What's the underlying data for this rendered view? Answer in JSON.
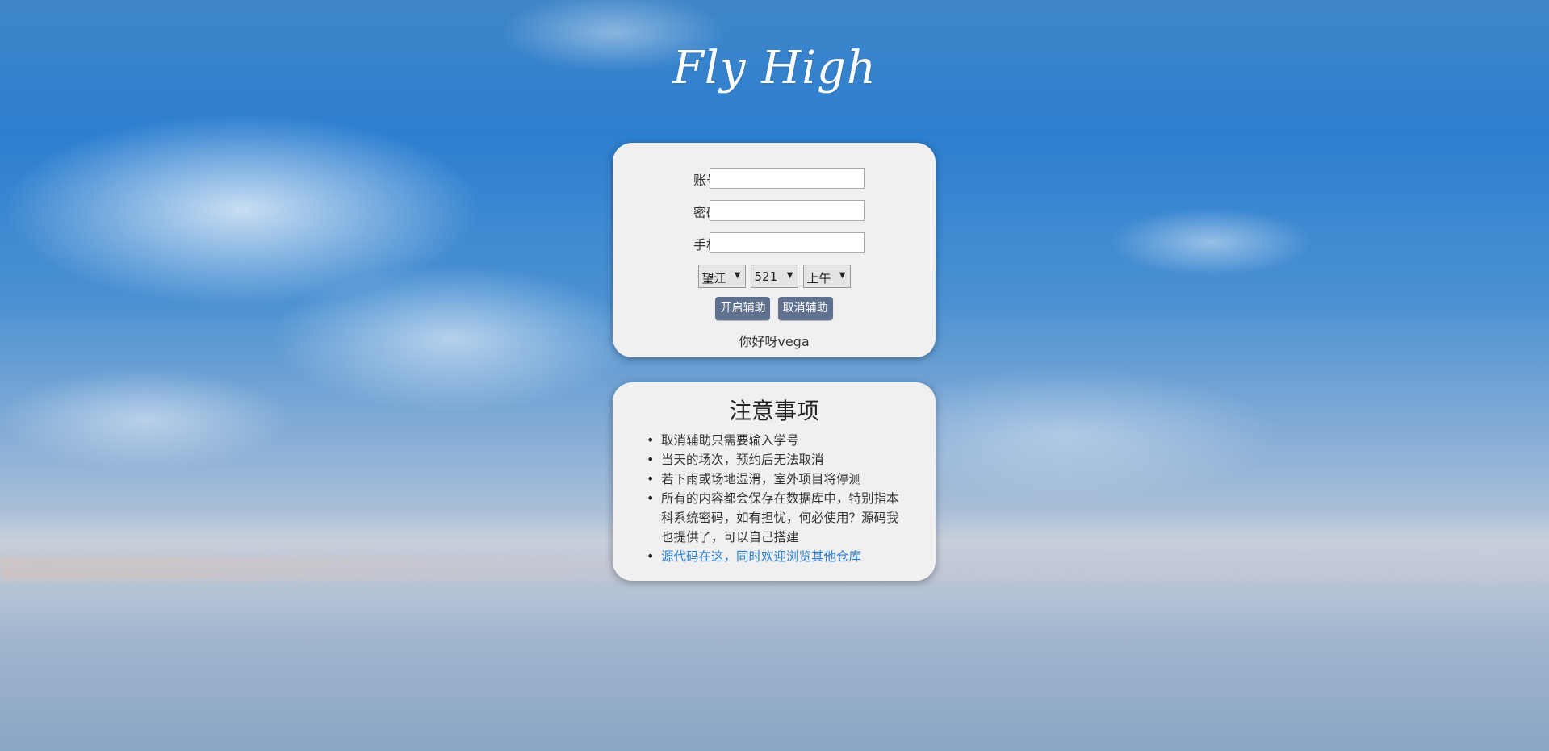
{
  "page": {
    "title": "Fly High"
  },
  "login": {
    "account_label": "账号",
    "account_value": "",
    "password_label": "密码",
    "password_value": "",
    "phone_label": "手机",
    "phone_value": "",
    "campus_select": "望江",
    "code_select": "521",
    "time_select": "上午",
    "start_button": "开启辅助",
    "cancel_button": "取消辅助",
    "greeting": "你好呀vega"
  },
  "notes": {
    "title": "注意事项",
    "items": [
      "取消辅助只需要输入学号",
      "当天的场次，预约后无法取消",
      "若下雨或场地湿滑，室外项目将停测",
      "所有的内容都会保存在数据库中，特别指本科系统密码，如有担忧，何必使用？源码我也提供了，可以自己搭建"
    ],
    "link": "源代码在这，同时欢迎浏览其他仓库"
  },
  "colors": {
    "button": "#5f718f",
    "link": "#2a7fd4",
    "card": "#f0f0f0"
  }
}
